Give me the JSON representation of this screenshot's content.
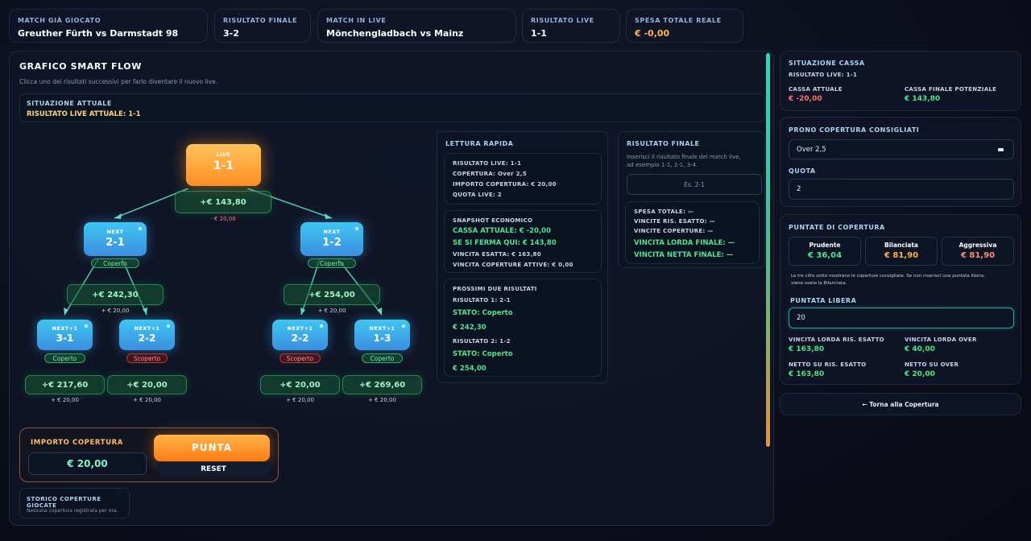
{
  "topbar": [
    {
      "label": "MATCH GIÀ GIOCATO",
      "value": "Greuther Fürth  vs  Darmstadt 98"
    },
    {
      "label": "RISULTATO FINALE",
      "value": "3-2"
    },
    {
      "label": "MATCH IN LIVE",
      "value": "Mönchengladbach  vs  Mainz"
    },
    {
      "label": "RISULTATO LIVE",
      "value": "1-1"
    },
    {
      "label": "SPESA TOTALE REALE",
      "value": "€ -0,00"
    }
  ],
  "flow": {
    "title": "GRAFICO SMART FLOW",
    "subtitle": "Clicca uno dei risultati successivi per farlo diventare il nuovo live.",
    "situation_label": "SITUAZIONE ATTUALE",
    "situation_value": "RISULTATO LIVE ATTUALE: 1-1"
  },
  "tree": {
    "live": {
      "tag": "LIVE",
      "score": "1-1",
      "win": "+€ 143,80",
      "sub": "- € 20,00"
    },
    "next": [
      {
        "tag": "NEXT",
        "score": "2-1",
        "status": "Coperto",
        "win": "+€ 242,30",
        "sub": "+ € 20,00"
      },
      {
        "tag": "NEXT",
        "score": "1-2",
        "status": "Coperto",
        "win": "+€ 254,00",
        "sub": "+ € 20,00"
      }
    ],
    "leaves": [
      {
        "tag": "NEXT+1",
        "score": "3-1",
        "status": "Coperto",
        "win": "+€ 217,60",
        "sub": "+ € 20,00"
      },
      {
        "tag": "NEXT+1",
        "score": "2-2",
        "status": "Scoperto",
        "win": "+€ 20,00",
        "sub": "+ € 20,00"
      },
      {
        "tag": "NEXT+1",
        "score": "2-2",
        "status": "Scoperto",
        "win": "+€ 20,00",
        "sub": "+ € 20,00"
      },
      {
        "tag": "NEXT+1",
        "score": "1-3",
        "status": "Coperto",
        "win": "+€ 269,60",
        "sub": "+ € 20,00"
      }
    ]
  },
  "bet": {
    "label": "IMPORTO COPERTURA",
    "amount": "€ 20,00",
    "punta": "PUNTA",
    "reset": "RESET"
  },
  "history": {
    "title": "STORICO COPERTURE GIOCATE",
    "empty": "Nessuna copertura registrata per ora."
  },
  "quick": {
    "title": "LETTURA RAPIDA",
    "block1": [
      "RISULTATO LIVE: 1-1",
      "COPERTURA: Over 2,5",
      "IMPORTO COPERTURA: € 20,00",
      "QUOTA LIVE: 2"
    ],
    "block2_title": "SNAPSHOT ECONOMICO",
    "block2_big1": "CASSA ATTUALE: € -20,00",
    "block2_big2": "SE SI FERMA QUI: € 143,80",
    "block2_small1": "VINCITA ESATTA: € 163,80",
    "block2_small2": "VINCITA COPERTURE ATTIVE: € 0,00",
    "block3_title": "PROSSIMI DUE RISULTATI",
    "r1_label": "RISULTATO 1: 2-1",
    "r1_state": "STATO: Coperto",
    "r1_value": "€ 242,30",
    "r2_label": "RISULTATO 2: 1-2",
    "r2_state": "STATO: Coperto",
    "r2_value": "€ 254,00"
  },
  "final": {
    "title": "RISULTATO FINALE",
    "desc1": "Inserisci il risultato finale del match live,",
    "desc2": "ad esempio 1-1, 2-1, 3-4.",
    "placeholder": "Es. 2-1",
    "spesa": "SPESA TOTALE: —",
    "vinc_ris": "VINCITE RIS. ESATTO: —",
    "vinc_cop": "VINCITE COPERTURE: —",
    "lorda": "VINCITA LORDA FINALE: —",
    "netta": "VINCITA NETTA FINALE: —"
  },
  "cassa": {
    "title": "SITUAZIONE CASSA",
    "sub": "RISULTATO LIVE: 1-1",
    "attuale_label": "CASSA ATTUALE",
    "attuale_value": "€ -20,00",
    "potenziale_label": "CASSA FINALE POTENZIALE",
    "potenziale_value": "€ 143,80"
  },
  "prono": {
    "title": "PRONO COPERTURA CONSIGLIATI",
    "select_value": "Over 2,5",
    "quota_label": "QUOTA",
    "quota_value": "2"
  },
  "puntate": {
    "title": "PUNTATE DI COPERTURA",
    "options": [
      {
        "name": "Prudente",
        "value": "€ 36,04"
      },
      {
        "name": "Bilanciata",
        "value": "€ 81,90"
      },
      {
        "name": "Aggressiva",
        "value": "€ 81,90"
      }
    ],
    "note1": "Le tre cifre sotto mostrano le coperture consigliate. Se non inserisci una puntata libera,",
    "note2": "viene usata la Bilanciata.",
    "libera_label": "PUNTATA LIBERA",
    "libera_value": "20",
    "stats": [
      {
        "label": "VINCITA LORDA RIS. ESATTO",
        "value": "€ 163,80"
      },
      {
        "label": "VINCITA LORDA OVER",
        "value": "€ 40,00"
      },
      {
        "label": "NETTO SU RIS. ESATTO",
        "value": "€ 163,80"
      },
      {
        "label": "NETTO SU OVER",
        "value": "€ 20,00"
      }
    ]
  },
  "back_button": "← Torna alla Copertura",
  "colors": {
    "accent_orange": "#ff9a2a",
    "accent_green": "#4ee38c",
    "accent_red": "#ff6f6f",
    "accent_blue": "#3ec6f2"
  }
}
